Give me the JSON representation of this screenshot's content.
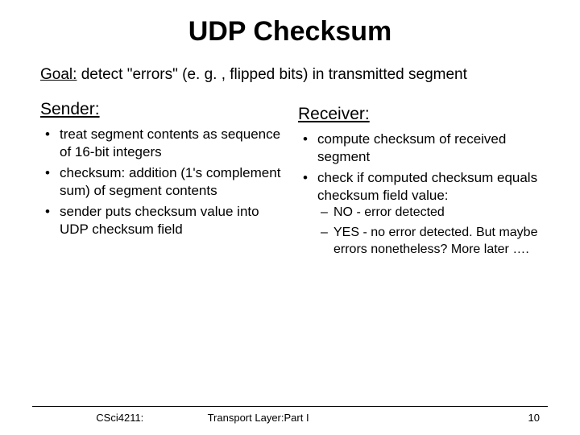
{
  "title": "UDP Checksum",
  "goal": {
    "label": "Goal:",
    "text": " detect \"errors\" (e. g. , flipped bits) in transmitted segment"
  },
  "sender": {
    "heading": "Sender:",
    "items": [
      "treat segment contents as sequence of 16-bit integers",
      "checksum: addition (1's complement sum) of segment contents",
      "sender puts checksum value into UDP checksum field"
    ]
  },
  "receiver": {
    "heading": "Receiver:",
    "items": [
      "compute checksum of received segment",
      "check if computed checksum equals checksum field value:"
    ],
    "subitems": [
      "NO - error detected",
      "YES - no error detected. But maybe errors nonetheless? More later …."
    ]
  },
  "footer": {
    "course": "CSci4211:",
    "section": "Transport Layer:Part I",
    "page": "10"
  }
}
